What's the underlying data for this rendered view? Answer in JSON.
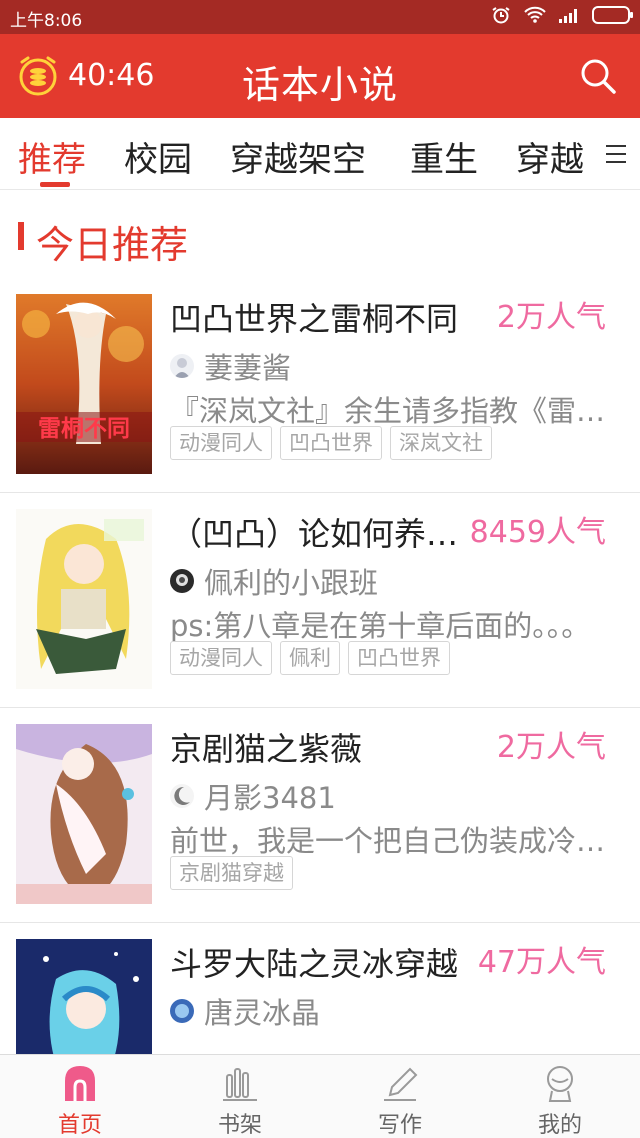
{
  "status_bar": {
    "time": "上午8:06"
  },
  "app_bar": {
    "timer": "40:46",
    "title": "话本小说"
  },
  "tabs": [
    {
      "label": "推荐",
      "active": true
    },
    {
      "label": "校园"
    },
    {
      "label": "穿越架空"
    },
    {
      "label": "重生"
    },
    {
      "label": "穿越"
    }
  ],
  "section": {
    "title": "今日推荐"
  },
  "books": [
    {
      "title": "凹凸世界之雷桐不同",
      "popularity": "2万人气",
      "author": "萋萋酱",
      "description": "『深岚文社』余生请多指教《雷桐不同》",
      "tags": [
        "动漫同人",
        "凹凸世界",
        "深岚文社"
      ],
      "cover_text": "雷桐不同"
    },
    {
      "title": "（凹凸）论如何养成一只佩利",
      "popularity": "8459人气",
      "author": "佩利的小跟班",
      "description": "ps:第八章是在第十章后面的。。。",
      "tags": [
        "动漫同人",
        "佩利",
        "凹凸世界"
      ]
    },
    {
      "title": "京剧猫之紫薇",
      "popularity": "2万人气",
      "author": "月影3481",
      "description": "前世，我是一个把自己伪装成冷漠的人",
      "tags": [
        "京剧猫穿越"
      ]
    },
    {
      "title": "斗罗大陆之灵冰穿越",
      "popularity": "47万人气",
      "author": "唐灵冰晶",
      "description": "",
      "tags": []
    }
  ],
  "bottom_nav": [
    {
      "label": "首页",
      "icon": "home-icon",
      "active": true
    },
    {
      "label": "书架",
      "icon": "bookshelf-icon"
    },
    {
      "label": "写作",
      "icon": "pen-icon"
    },
    {
      "label": "我的",
      "icon": "profile-icon"
    }
  ],
  "colors": {
    "accent": "#e33a2e",
    "status_bar": "#a42a24",
    "popularity": "#ef6aa0",
    "secondary_text": "#8a8a8a"
  }
}
